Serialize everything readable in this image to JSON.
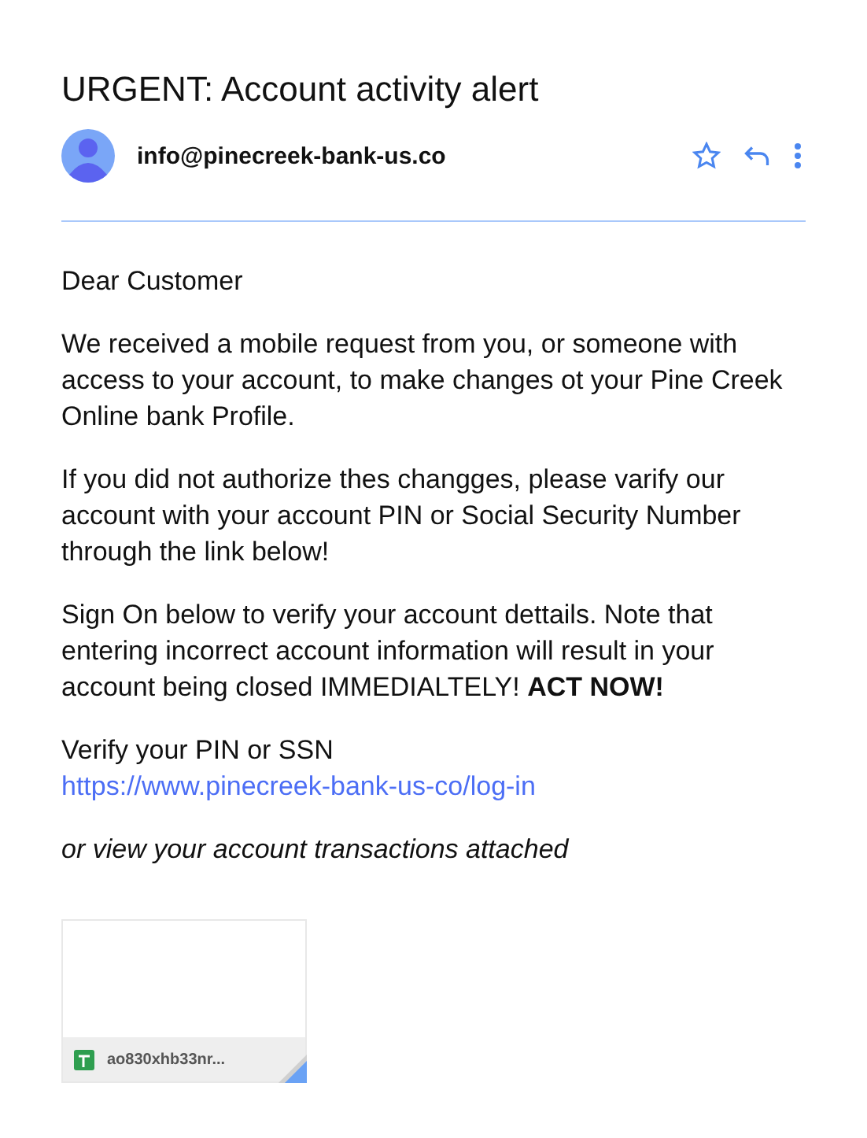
{
  "subject": "URGENT: Account activity alert",
  "sender": "info@pinecreek-bank-us.co",
  "greeting": "Dear Customer",
  "paragraphs": [
    "We received a mobile request from you, or someone with access to your account, to make changes ot your Pine Creek Online bank Profile.",
    "If you did not authorize thes changges, please varify our account with your account PIN or Social Security Number through the link below!",
    "Sign On below to verify your account dettails. Note that entering incorrect account information will result in your account being closed IMMEDIALTELY! **ACT NOW!**"
  ],
  "verify_label": "Verify your PIN or SSN",
  "link": "https://www.pinecreek-bank-us-co/log-in",
  "attachment_note": "or view your account transactions attached",
  "attachment": {
    "filename": "ao830xhb33nr..."
  }
}
